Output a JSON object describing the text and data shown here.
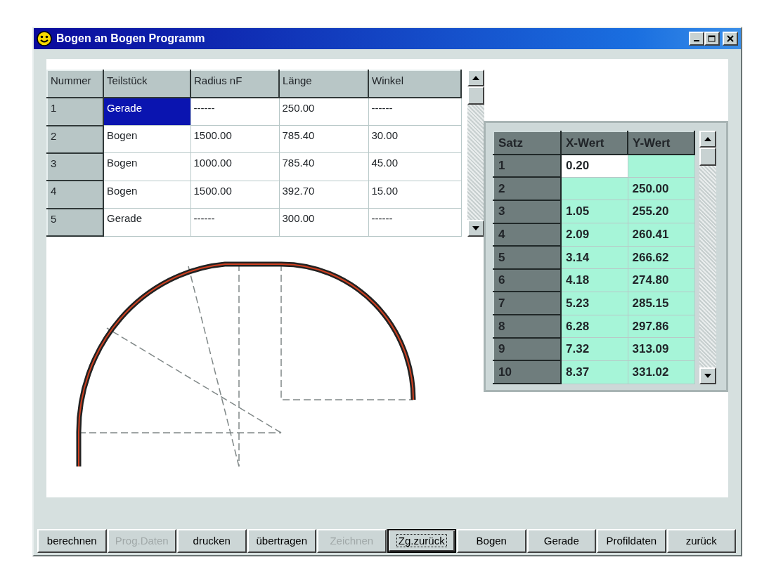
{
  "window": {
    "title": "Bogen an Bogen Programm"
  },
  "segments_table": {
    "columns": [
      "Nummer",
      "Teilstück",
      "Radius nF",
      "Länge",
      "Winkel"
    ],
    "rows": [
      {
        "cells": [
          {
            "kind": "header",
            "text": "1"
          },
          {
            "kind": "data",
            "text": "Gerade",
            "selected": true
          },
          {
            "kind": "data",
            "text": "------",
            "selected": false
          },
          {
            "kind": "data",
            "text": "250.00",
            "selected": false
          },
          {
            "kind": "data",
            "text": "------",
            "selected": false
          }
        ]
      },
      {
        "cells": [
          {
            "kind": "header",
            "text": "2"
          },
          {
            "kind": "data",
            "text": "Bogen",
            "selected": false
          },
          {
            "kind": "data",
            "text": "1500.00",
            "selected": false
          },
          {
            "kind": "data",
            "text": "785.40",
            "selected": false
          },
          {
            "kind": "data",
            "text": "30.00",
            "selected": false
          }
        ]
      },
      {
        "cells": [
          {
            "kind": "header",
            "text": "3"
          },
          {
            "kind": "data",
            "text": "Bogen",
            "selected": false
          },
          {
            "kind": "data",
            "text": "1000.00",
            "selected": false
          },
          {
            "kind": "data",
            "text": "785.40",
            "selected": false
          },
          {
            "kind": "data",
            "text": "45.00",
            "selected": false
          }
        ]
      },
      {
        "cells": [
          {
            "kind": "header",
            "text": "4"
          },
          {
            "kind": "data",
            "text": "Bogen",
            "selected": false
          },
          {
            "kind": "data",
            "text": "1500.00",
            "selected": false
          },
          {
            "kind": "data",
            "text": "392.70",
            "selected": false
          },
          {
            "kind": "data",
            "text": "15.00",
            "selected": false
          }
        ]
      },
      {
        "cells": [
          {
            "kind": "header",
            "text": "5"
          },
          {
            "kind": "data",
            "text": "Gerade",
            "selected": false
          },
          {
            "kind": "data",
            "text": "------",
            "selected": false
          },
          {
            "kind": "data",
            "text": "300.00",
            "selected": false
          },
          {
            "kind": "data",
            "text": "------",
            "selected": false
          }
        ]
      }
    ]
  },
  "points_table": {
    "columns": [
      "Satz",
      "X-Wert",
      "Y-Wert"
    ],
    "rows": [
      {
        "cells": [
          {
            "kind": "header",
            "text": "1"
          },
          {
            "kind": "data",
            "text": "0.20",
            "selected": true
          },
          {
            "kind": "data",
            "selected": false
          }
        ]
      },
      {
        "cells": [
          {
            "kind": "header",
            "text": "2"
          },
          {
            "kind": "data",
            "selected": false
          },
          {
            "kind": "data",
            "text": "250.00",
            "selected": false
          }
        ]
      },
      {
        "cells": [
          {
            "kind": "header",
            "text": "3"
          },
          {
            "kind": "data",
            "text": "1.05",
            "selected": false
          },
          {
            "kind": "data",
            "text": "255.20",
            "selected": false
          }
        ]
      },
      {
        "cells": [
          {
            "kind": "header",
            "text": "4"
          },
          {
            "kind": "data",
            "text": "2.09",
            "selected": false
          },
          {
            "kind": "data",
            "text": "260.41",
            "selected": false
          }
        ]
      },
      {
        "cells": [
          {
            "kind": "header",
            "text": "5"
          },
          {
            "kind": "data",
            "text": "3.14",
            "selected": false
          },
          {
            "kind": "data",
            "text": "266.62",
            "selected": false
          }
        ]
      },
      {
        "cells": [
          {
            "kind": "header",
            "text": "6"
          },
          {
            "kind": "data",
            "text": "4.18",
            "selected": false
          },
          {
            "kind": "data",
            "text": "274.80",
            "selected": false
          }
        ]
      },
      {
        "cells": [
          {
            "kind": "header",
            "text": "7"
          },
          {
            "kind": "data",
            "text": "5.23",
            "selected": false
          },
          {
            "kind": "data",
            "text": "285.15",
            "selected": false
          }
        ]
      },
      {
        "cells": [
          {
            "kind": "header",
            "text": "8"
          },
          {
            "kind": "data",
            "text": "6.28",
            "selected": false
          },
          {
            "kind": "data",
            "text": "297.86",
            "selected": false
          }
        ]
      },
      {
        "cells": [
          {
            "kind": "header",
            "text": "9"
          },
          {
            "kind": "data",
            "text": "7.32",
            "selected": false
          },
          {
            "kind": "data",
            "text": "313.09",
            "selected": false
          }
        ]
      },
      {
        "cells": [
          {
            "kind": "header",
            "text": "10"
          },
          {
            "kind": "data",
            "text": "8.37",
            "selected": false
          },
          {
            "kind": "data",
            "text": "331.02",
            "selected": false
          }
        ]
      }
    ]
  },
  "buttons": [
    {
      "label": "berechnen",
      "disabled": false,
      "focused": false
    },
    {
      "label": "Prog.Daten",
      "disabled": true,
      "focused": false
    },
    {
      "label": "drucken",
      "disabled": false,
      "focused": false
    },
    {
      "label": "übertragen",
      "disabled": false,
      "focused": false
    },
    {
      "label": "Zeichnen",
      "disabled": true,
      "focused": false
    },
    {
      "label": "Zg.zurück",
      "disabled": false,
      "focused": true
    },
    {
      "label": "Bogen",
      "disabled": false,
      "focused": false
    },
    {
      "label": "Gerade",
      "disabled": false,
      "focused": false
    },
    {
      "label": "Profildaten",
      "disabled": false,
      "focused": false
    },
    {
      "label": "zurück",
      "disabled": false,
      "focused": false
    }
  ]
}
